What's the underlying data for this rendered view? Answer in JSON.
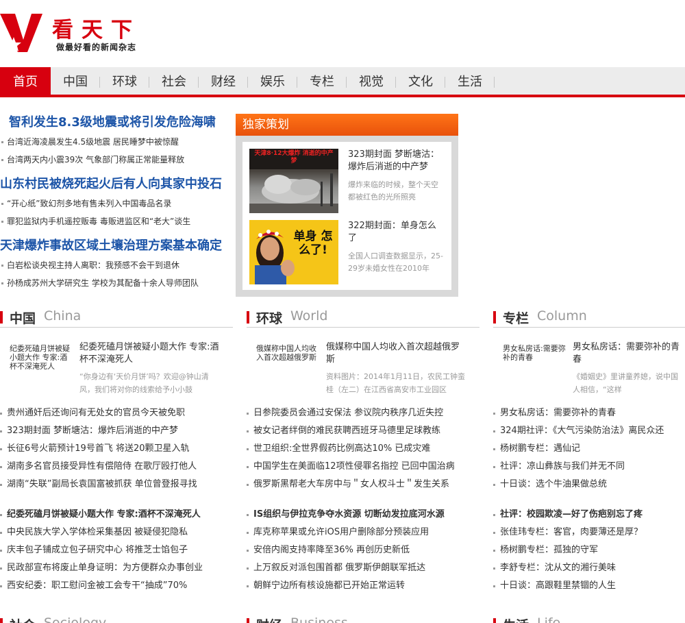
{
  "brand": {
    "name": "看天下",
    "slogan": "做最好看的新闻杂志"
  },
  "nav": [
    "首页",
    "中国",
    "环球",
    "社会",
    "财经",
    "娱乐",
    "专栏",
    "视觉",
    "文化",
    "生活"
  ],
  "headlines": [
    {
      "title": "智利发生8.3级地震或将引发危险海啸",
      "subs": [
        "台湾近海凌晨发生4.5级地震 居民睡梦中被惊醒",
        "台湾两天内小震39次 气象部门称属正常能量释放"
      ]
    },
    {
      "title": "山东村民被烧死起火后有人向其家中投石",
      "subs": [
        "“开心纸”致幻剂多地有售未列入中国毒品名录",
        "罪犯监狱内手机遥控贩毒 毒贩进监区和“老大”谈生"
      ]
    },
    {
      "title": "天津爆炸事故区域土壤治理方案基本确定",
      "subs": [
        "白岩松谈央视主持人离职：我预感不会干到退休",
        "孙杨成苏州大学研究生 学校为其配备十余人导师团队"
      ]
    }
  ],
  "exclusive": {
    "header": "独家策划",
    "items": [
      {
        "title": "323期封面 梦断塘沽：爆炸后消逝的中产梦",
        "desc": "爆炸来临的时候，整个天空都被红色的光所照亮",
        "thumb_caption": "天津8·12大爆炸 消逝的中产梦"
      },
      {
        "title": "322期封面：单身怎么了",
        "desc": "全国人口调查数据显示，25-29岁未婚女性在2010年",
        "thumb_caption": "单身 怎么了!"
      }
    ]
  },
  "sections": [
    {
      "cn": "中国",
      "en": "China",
      "feature": {
        "pic_text": "纪委死磕月饼被疑小题大作 专家:酒杯不深淹死人",
        "title": "纪委死磕月饼被疑小题大作 专家:酒杯不深淹死人",
        "desc": "“你身边有‘天价月饼’吗？欢迎@钟山清风，我们将对你的线索给予小小鼓"
      },
      "list1": [
        "贵州通奸后还询问有无处女的官员今天被免职",
        "323期封面 梦断塘沽：爆炸后消逝的中产梦",
        "长征6号火箭预计19号首飞 将送20颗卫星入轨",
        "湖南多名官员接受异性有偿陪侍 在歌厅殴打他人",
        "湖南“失联”副局长袁国富被抓获 单位曾登报寻找"
      ],
      "list2": [
        "纪委死磕月饼被疑小题大作 专家:酒杯不深淹死人",
        "中央民族大学入学体检采集基因 被疑侵犯隐私",
        "庆丰包子铺成立包子研究中心 将推芝士馅包子",
        "民政部宣布将废止单身证明：为方便群众办事创业",
        "西安纪委：职工慰问金被工会专干“抽成”70%"
      ]
    },
    {
      "cn": "环球",
      "en": "World",
      "feature": {
        "pic_text": "俄媒称中国人均收入首次超越俄罗斯",
        "title": "俄媒称中国人均收入首次超越俄罗斯",
        "desc": "资料图片：2014年1月11日，农民工钟蛮桂（左二）在江西省高安市工业园区"
      },
      "list1": [
        "日参院委员会通过安保法 参议院内秩序几近失控",
        "被女记者绊倒的难民获聘西班牙马德里足球教练",
        "世卫组织:全世界假药比例高达10% 已成灾难",
        "中国学生在美面临12项性侵罪名指控 已回中国治病",
        "俄罗斯黑帮老大车房中与＂女人权斗士＂发生关系"
      ],
      "list2": [
        "IS组织与伊拉克争夺水资源 切断幼发拉底河水源",
        "库克称苹果或允许iOS用户删除部分预装应用",
        "安倍内阁支持率降至36% 再创历史新低",
        "上万叙反对派包围首都 俄罗斯伊朗联军抵达",
        "朝鲜宁边所有核设施都已开始正常运转"
      ]
    },
    {
      "cn": "专栏",
      "en": "Column",
      "feature": {
        "pic_text": "男女私房话:需要弥补的青春",
        "title": "男女私房话：需要弥补的青春",
        "desc": "《婚姻史》里讲童养媳，说中国人相信，“这样"
      },
      "list1": [
        "男女私房话：需要弥补的青春",
        "324期社评：《大气污染防治法》离民众还",
        "杨树鹏专栏：遇仙记",
        "社评：凉山彝族与我们并无不同",
        "十日谈：选个牛油果做总统"
      ],
      "list2": [
        "社评：校园欺凌—好了伤疤别忘了疼",
        "张佳玮专栏：客官，肉要薄还是厚？",
        "杨树鹏专栏：孤独的守军",
        "李舒专栏：沈从文的湘行美味",
        "十日谈：高跟鞋里禁锢的人生"
      ]
    }
  ],
  "bottom_sections": [
    {
      "cn": "社会",
      "en": "Sociology"
    },
    {
      "cn": "财经",
      "en": "Business"
    },
    {
      "cn": "生活",
      "en": "Life"
    }
  ]
}
